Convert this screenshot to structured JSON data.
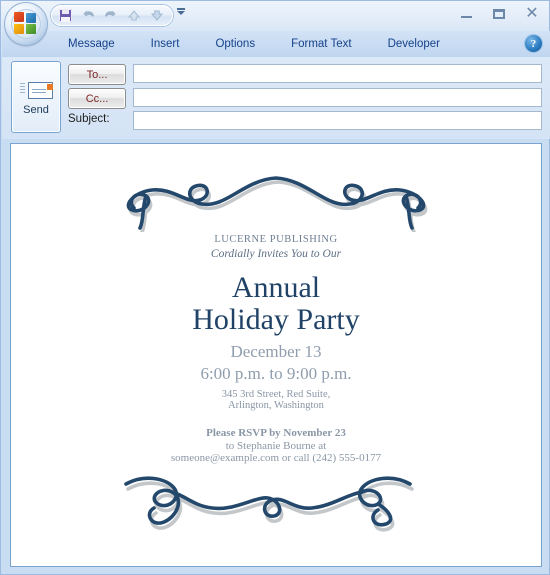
{
  "window": {
    "app": "outlook-message-compose",
    "office_orb_label": "Office Button",
    "controls": {
      "minimize": "–",
      "maximize": "▭",
      "close": "✕"
    }
  },
  "quick_access_toolbar": {
    "items": [
      {
        "name": "save-icon",
        "label": "Save"
      },
      {
        "name": "undo-icon",
        "label": "Undo"
      },
      {
        "name": "redo-icon",
        "label": "Redo"
      },
      {
        "name": "previous-item-icon",
        "label": "Previous Item"
      },
      {
        "name": "next-item-icon",
        "label": "Next Item"
      },
      {
        "name": "customize-qat-icon",
        "label": "Customize Quick Access Toolbar"
      }
    ]
  },
  "ribbon": {
    "tabs": [
      {
        "label": "Message",
        "active": true
      },
      {
        "label": "Insert",
        "active": false
      },
      {
        "label": "Options",
        "active": false
      },
      {
        "label": "Format Text",
        "active": false
      },
      {
        "label": "Developer",
        "active": false
      }
    ],
    "help_label": "?"
  },
  "compose": {
    "send_label": "Send",
    "to_label": "To...",
    "cc_label": "Cc...",
    "subject_label": "Subject:",
    "to_value": "",
    "cc_value": "",
    "subject_value": "",
    "to_placeholder": "",
    "cc_placeholder": "",
    "subject_placeholder": ""
  },
  "invitation": {
    "organization": "LUCERNE PUBLISHING",
    "tagline": "Cordially Invites You to Our",
    "title_line1": "Annual",
    "title_line2": "Holiday Party",
    "date": "December 13",
    "time": "6:00 p.m. to 9:00 p.m.",
    "address_line1": "345 3rd Street, Red Suite,",
    "address_line2": "Arlington, Washington",
    "rsvp_line1": "Please RSVP by November 23",
    "rsvp_line2": "to  Stephanie Bourne at",
    "rsvp_line3": "someone@example.com or call (242) 555-0177",
    "ornament_top_name": "flourish-ornament-top",
    "ornament_bottom_name": "flourish-ornament-bottom"
  },
  "colors": {
    "accent_navy": "#1f4266",
    "muted_gray": "#8a97a6",
    "chrome_blue": "#15428b",
    "ornament_shadow": "#bfc4c8"
  }
}
